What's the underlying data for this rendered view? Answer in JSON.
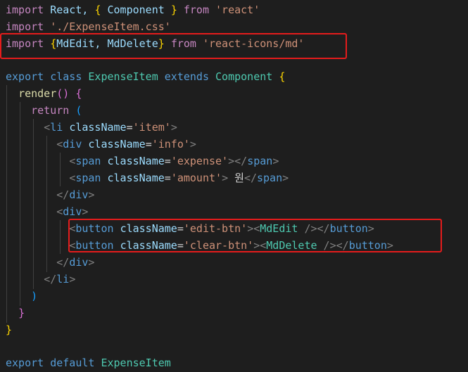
{
  "code": {
    "l1": {
      "import": "import",
      "react": "React,",
      "open": "{",
      "component": "Component",
      "close": "}",
      "from": "from",
      "src": "'react'"
    },
    "l2": {
      "import": "import",
      "src": "'./ExpenseItem.css'"
    },
    "l3": {
      "import": "import",
      "open": "{",
      "edit": "MdEdit,",
      "del": "MdDelete",
      "close": "}",
      "from": "from",
      "src": "'react-icons/md'"
    },
    "l5": {
      "export": "export",
      "class": "class",
      "name": "ExpenseItem",
      "extends": "extends",
      "parent": "Component",
      "open": "{"
    },
    "l6": {
      "render": "render",
      "parens": "()",
      "open": "{"
    },
    "l7": {
      "return": "return",
      "open": "("
    },
    "l8": {
      "lt": "<",
      "tag": "li",
      "attr": "className",
      "eq": "=",
      "val": "'item'",
      "gt": ">"
    },
    "l9": {
      "lt": "<",
      "tag": "div",
      "attr": "className",
      "eq": "=",
      "val": "'info'",
      "gt": ">"
    },
    "l10": {
      "lt": "<",
      "tag": "span",
      "attr": "className",
      "eq": "=",
      "val": "'expense'",
      "mid": "></",
      "ctag": "span",
      "gt": ">"
    },
    "l11": {
      "lt": "<",
      "tag": "span",
      "attr": "className",
      "eq": "=",
      "val": "'amount'",
      "gt1": ">",
      "text": " 원",
      "clt": "</",
      "ctag": "span",
      "gt": ">"
    },
    "l12": {
      "lt": "</",
      "tag": "div",
      "gt": ">"
    },
    "l13": {
      "lt": "<",
      "tag": "div",
      "gt": ">"
    },
    "l14": {
      "lt": "<",
      "tag": "button",
      "attr": "className",
      "eq": "=",
      "val": "'edit-btn'",
      "gt1": "><",
      "comp": "MdEdit",
      "selfclose": " />",
      "clt": "</",
      "ctag": "button",
      "gt": ">"
    },
    "l15": {
      "lt": "<",
      "tag": "button",
      "attr": "className",
      "eq": "=",
      "val": "'clear-btn'",
      "gt1": "><",
      "comp": "MdDelete",
      "selfclose": " />",
      "clt": "</",
      "ctag": "button",
      "gt": ">"
    },
    "l16": {
      "lt": "</",
      "tag": "div",
      "gt": ">"
    },
    "l17": {
      "lt": "</",
      "tag": "li",
      "gt": ">"
    },
    "l18": {
      "close": ")"
    },
    "l19": {
      "close": "}"
    },
    "l20": {
      "close": "}"
    },
    "l22": {
      "export": "export",
      "default": "default",
      "name": "ExpenseItem"
    }
  },
  "colors": {
    "background": "#1e1e1e",
    "keyword": "#c586c0",
    "storage": "#569cd6",
    "variable": "#9cdcfe",
    "type": "#4ec9b0",
    "string": "#ce9178",
    "function": "#dcdcaa",
    "highlight_box": "#e51c1c"
  }
}
